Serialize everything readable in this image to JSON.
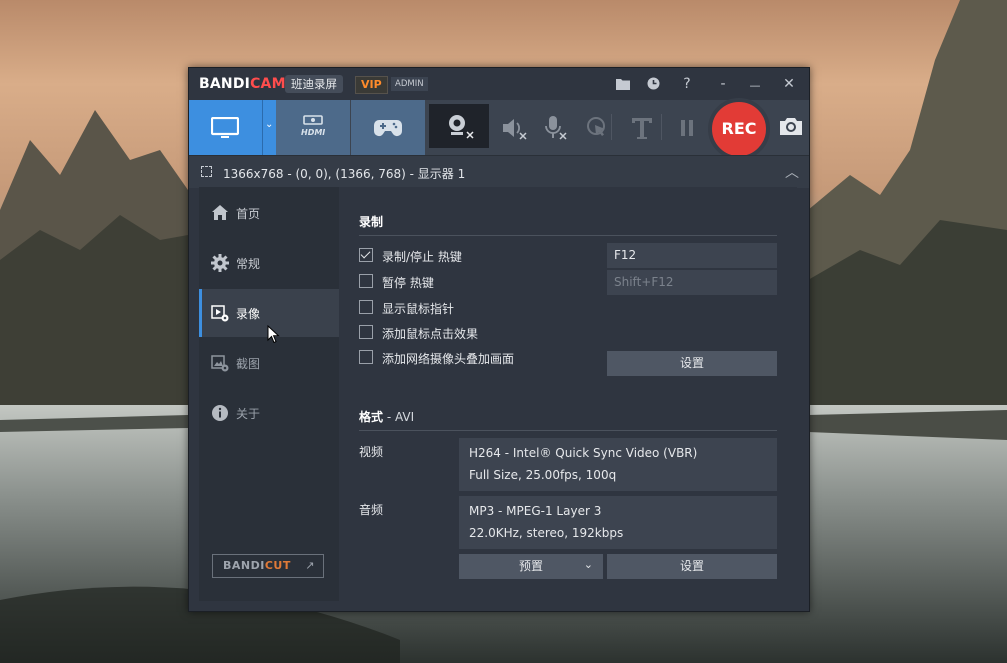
{
  "app": {
    "brand": "BANDI",
    "brand_accent": "CAM",
    "brand_cn": "班迪录屏",
    "vip_badge": "VIP",
    "admin_badge": "ADMIN",
    "accent_color": "#3d8fe0",
    "rec_color": "#e23b36"
  },
  "titlebar_buttons": [
    {
      "name": "folder-icon"
    },
    {
      "name": "clock-icon"
    },
    {
      "name": "help-icon",
      "glyph": "?"
    },
    {
      "name": "minimize-to-tray-icon",
      "glyph": "-"
    },
    {
      "name": "minimize-icon",
      "glyph": "—"
    },
    {
      "name": "close-icon",
      "glyph": "✕"
    }
  ],
  "toolbar": {
    "hdmi_label": "HDMI",
    "rec_label": "REC"
  },
  "target_bar": {
    "text": "1366x768 - (0, 0), (1366, 768) - 显示器 1"
  },
  "sidebar": {
    "items": [
      {
        "label": "首页",
        "icon": "home-icon"
      },
      {
        "label": "常规",
        "icon": "gear-icon"
      },
      {
        "label": "录像",
        "icon": "video-settings-icon",
        "active": true
      },
      {
        "label": "截图",
        "icon": "image-settings-icon"
      },
      {
        "label": "关于",
        "icon": "info-icon"
      }
    ],
    "bandicut_a": "BANDI",
    "bandicut_b": "CUT",
    "bandicut_arrow": "↗"
  },
  "record": {
    "title": "录制",
    "options": [
      {
        "label": "录制/停止 热键",
        "checked": true
      },
      {
        "label": "暂停 热键",
        "checked": false
      },
      {
        "label": "显示鼠标指针",
        "checked": false
      },
      {
        "label": "添加鼠标点击效果",
        "checked": false
      },
      {
        "label": "添加网络摄像头叠加画面",
        "checked": false
      }
    ],
    "hotkey_record": "F12",
    "hotkey_pause": "Shift+F12",
    "settings_button": "设置"
  },
  "format": {
    "title": "格式",
    "title_suffix": " - AVI",
    "video_label": "视频",
    "video_line1": "H264 - Intel® Quick Sync Video (VBR)",
    "video_line2": "Full Size, 25.00fps, 100q",
    "audio_label": "音频",
    "audio_line1": "MP3 - MPEG-1 Layer 3",
    "audio_line2": "22.0KHz, stereo, 192kbps",
    "preset_button": "预置",
    "settings_button": "设置"
  }
}
